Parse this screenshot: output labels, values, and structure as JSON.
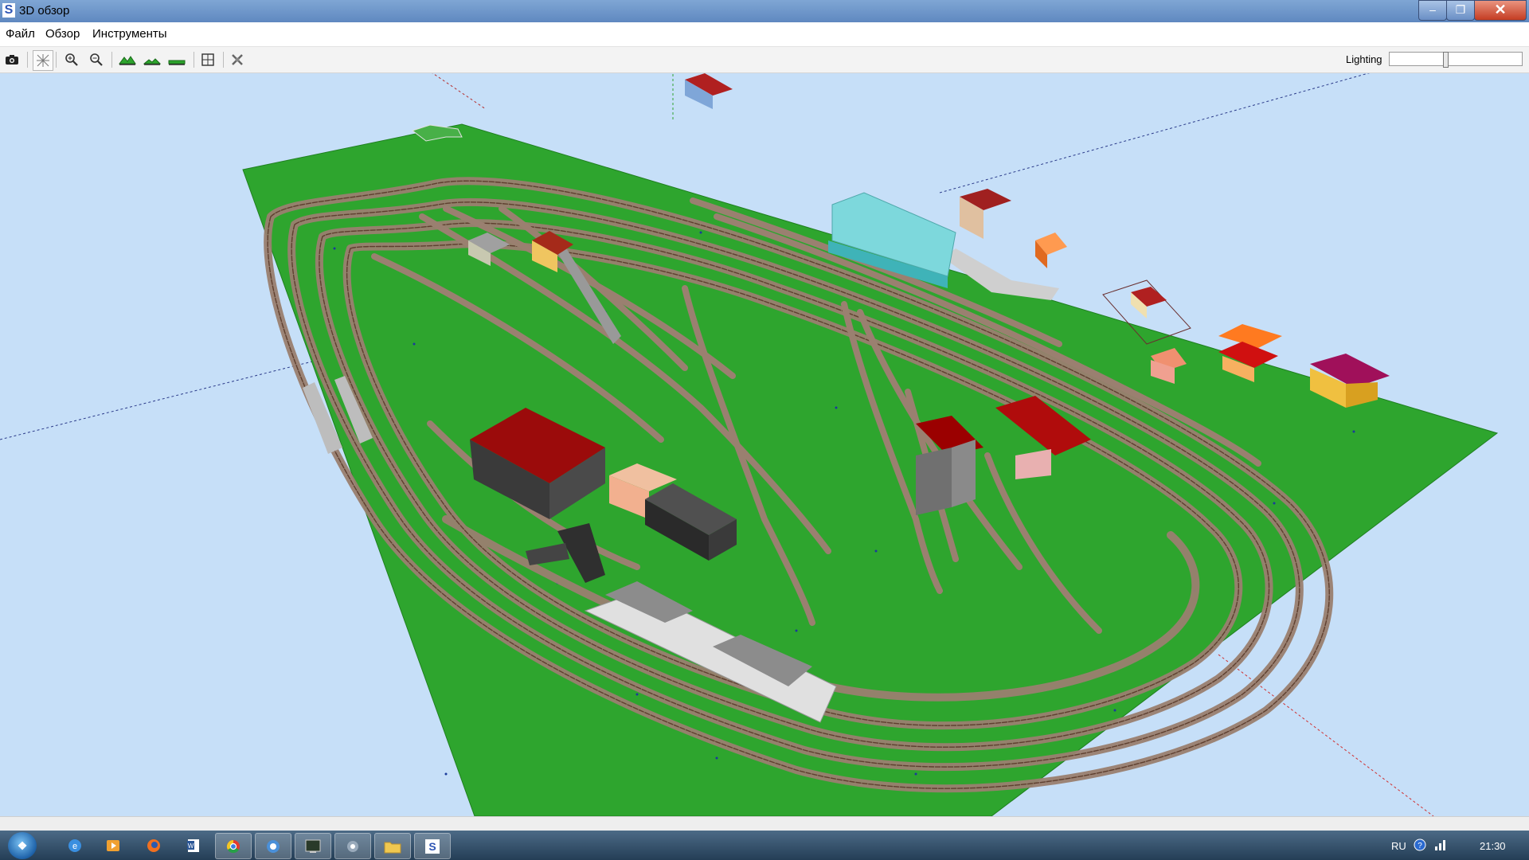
{
  "window": {
    "title": "3D обзор",
    "app_icon_letter": "S",
    "buttons": {
      "minimize": "–",
      "maximize": "❐",
      "close": "✕"
    }
  },
  "menu": {
    "file": "Файл",
    "view": "Обзор",
    "tools": "Инструменты"
  },
  "toolbar": {
    "icons": [
      "camera-icon",
      "axes-icon",
      "zoom-in-icon",
      "zoom-out-icon",
      "terrain-high-icon",
      "terrain-medium-icon",
      "terrain-flat-icon",
      "grid-icon",
      "settings-icon"
    ],
    "lighting_label": "Lighting",
    "lighting_level": 0.42
  },
  "scene": {
    "ground_color": "#2ea52e",
    "background_color": "#c6dff8",
    "track_color": "#8d6e63"
  },
  "taskbar": {
    "language": "RU",
    "clock": "21:30",
    "items": [
      "ie-icon",
      "media-player-icon",
      "firefox-icon",
      "word-icon",
      "chrome-icon",
      "app-icon",
      "terminal-icon",
      "tool-icon",
      "folder-icon",
      "scarm-icon"
    ]
  }
}
